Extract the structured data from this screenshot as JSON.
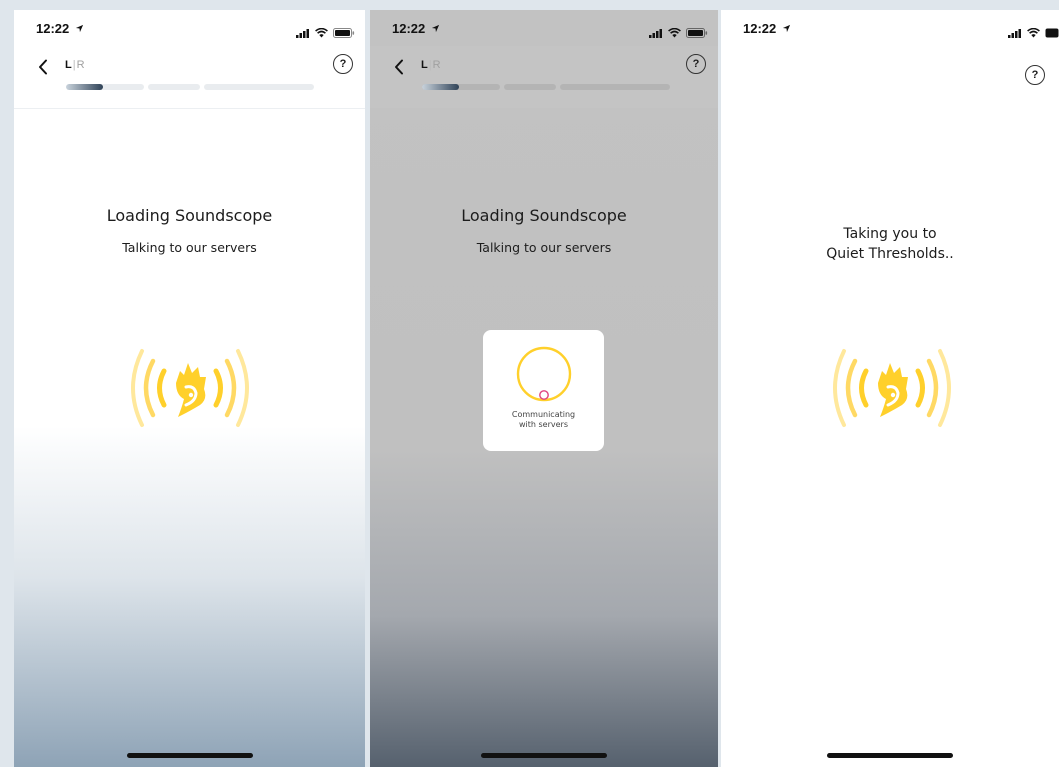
{
  "screens": [
    {
      "clock": "12:22",
      "ear_left": "L",
      "ear_separator": "|",
      "ear_right": "R",
      "help_label": "?",
      "title": "Loading Soundscope",
      "subtitle": "Talking to our servers",
      "progress_fraction": 0.15
    },
    {
      "clock": "12:22",
      "ear_left": "L",
      "ear_separator": "|",
      "ear_right": "R",
      "help_label": "?",
      "title": "Loading Soundscope",
      "subtitle": "Talking to our servers",
      "modal_line1": "Communicating",
      "modal_line2": "with servers",
      "progress_fraction": 0.15
    },
    {
      "clock": "12:22",
      "help_label": "?",
      "message_line1": "Taking you to",
      "message_line2": "Quiet Thresholds.."
    }
  ],
  "icons": {
    "back": "chevron-left-icon",
    "help": "question-circle-icon",
    "location": "location-arrow-icon",
    "signal": "cellular-signal-icon",
    "wifi": "wifi-icon",
    "battery": "battery-icon",
    "logo": "soundscope-broadcast-logo"
  },
  "colors": {
    "brand_yellow": "#ffd02b",
    "brand_yellow_light": "#ffe79a",
    "progress_fill": "#2f4257",
    "spinner_dot": "#e0447f"
  }
}
